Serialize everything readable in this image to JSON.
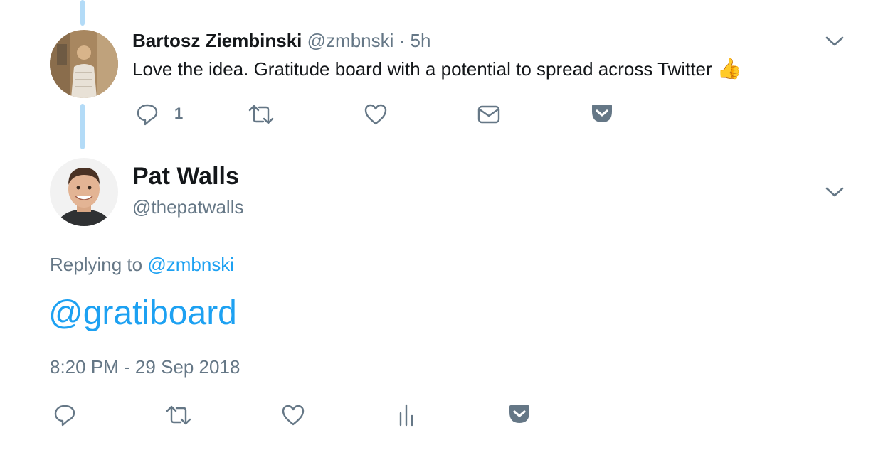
{
  "reply_tweet": {
    "author_name": "Bartosz Ziembinski",
    "author_handle": "@zmbnski",
    "separator": "·",
    "time_ago": "5h",
    "text": "Love the idea. Gratitude board with a potential to spread across Twitter",
    "emoji": "👍",
    "actions": {
      "reply_count": "1",
      "icons": [
        "reply-icon",
        "retweet-icon",
        "like-icon",
        "direct-message-icon",
        "pocket-icon"
      ]
    }
  },
  "main_tweet": {
    "author_name": "Pat Walls",
    "author_handle": "@thepatwalls",
    "replying_prefix": "Replying to",
    "replying_handle": "@zmbnski",
    "text": "@gratiboard",
    "timestamp": "8:20 PM - 29 Sep 2018",
    "actions": {
      "icons": [
        "reply-icon",
        "retweet-icon",
        "like-icon",
        "analytics-icon",
        "pocket-icon"
      ]
    }
  },
  "colors": {
    "link_blue": "#1da1f2",
    "secondary_grey": "#657786",
    "thread_line": "#b3dbf7",
    "text_dark": "#14171a"
  }
}
